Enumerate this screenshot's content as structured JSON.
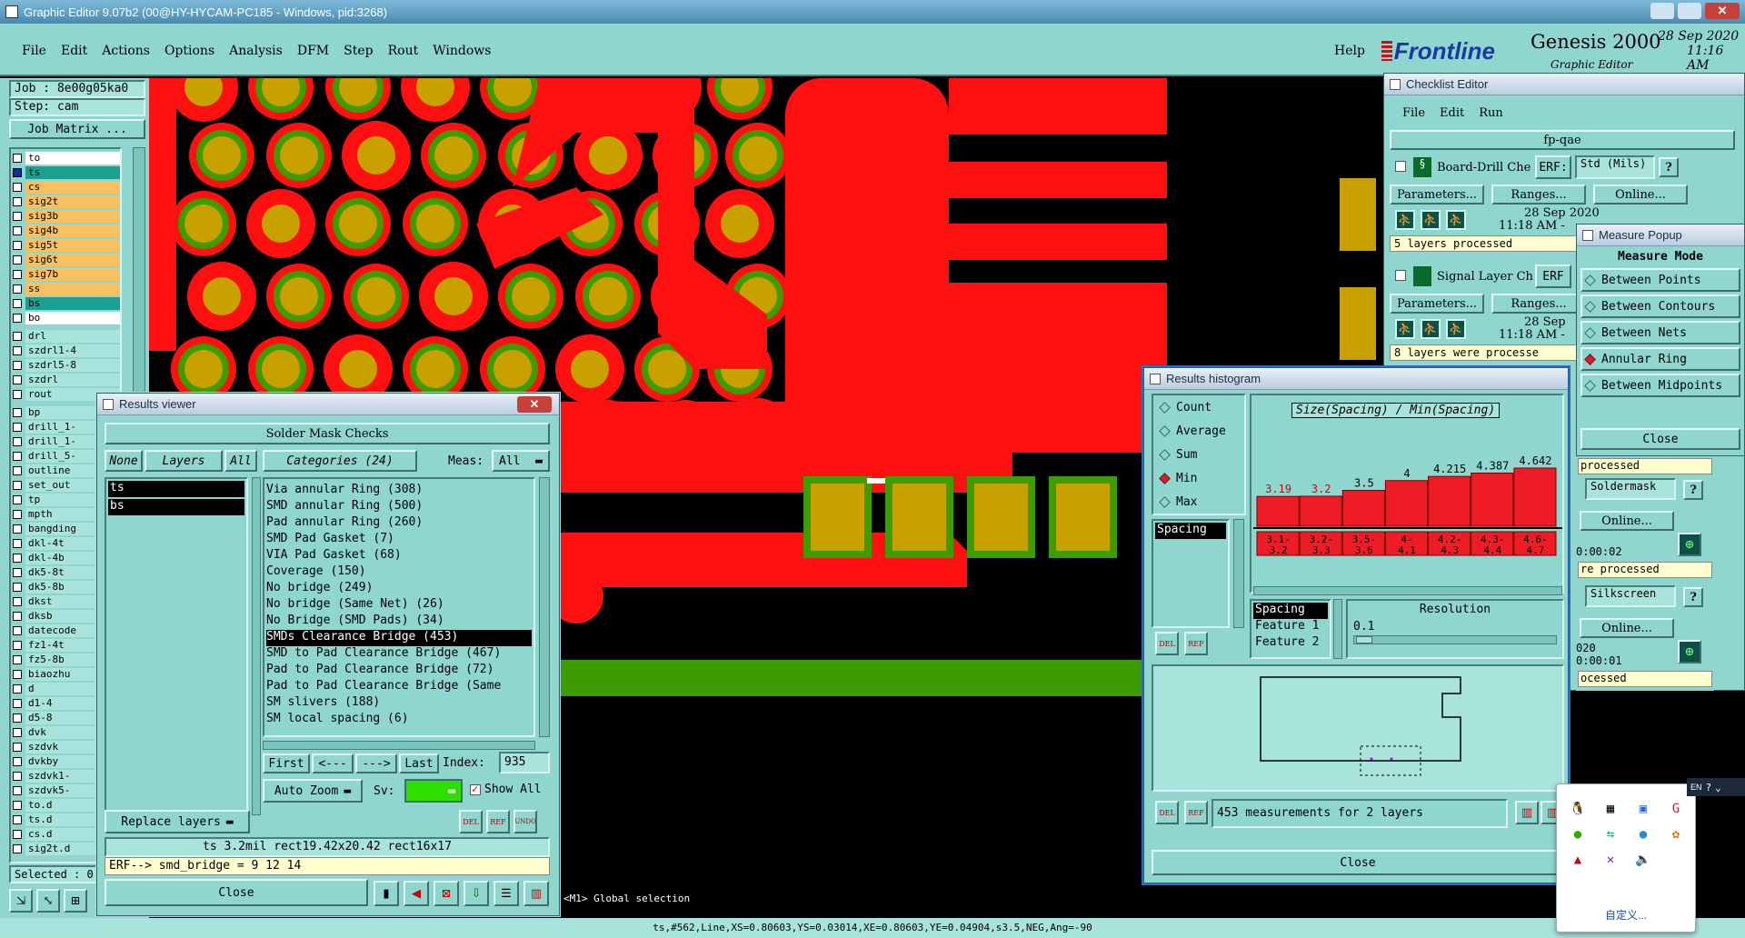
{
  "window": {
    "title": "Graphic Editor 9.07b2 (00@HY-HYCAM-PC185 - Windows, pid:3268)"
  },
  "menu": [
    "File",
    "Edit",
    "Actions",
    "Options",
    "Analysis",
    "DFM",
    "Step",
    "Rout",
    "Windows"
  ],
  "help_label": "Help",
  "brand": {
    "logo": "Frontline",
    "product": "Genesis 2000",
    "date": "28 Sep 2020",
    "time": "11:16 AM",
    "subtitle": "Graphic Editor"
  },
  "job": {
    "job_label": "Job : 8e00g05ka0",
    "step_label": "Step: cam",
    "matrix_button": "Job Matrix ..."
  },
  "layers": [
    {
      "name": "to",
      "color": "#ffffff"
    },
    {
      "name": "ts",
      "color": "#19a090"
    },
    {
      "name": "cs",
      "color": "#f8c060"
    },
    {
      "name": "sig2t",
      "color": "#f8c060"
    },
    {
      "name": "sig3b",
      "color": "#f8c060"
    },
    {
      "name": "sig4b",
      "color": "#f8c060"
    },
    {
      "name": "sig5t",
      "color": "#f8c060"
    },
    {
      "name": "sig6t",
      "color": "#f8c060"
    },
    {
      "name": "sig7b",
      "color": "#f8c060"
    },
    {
      "name": "ss",
      "color": "#f8c060"
    },
    {
      "name": "bs",
      "color": "#19a090"
    },
    {
      "name": "bo",
      "color": "#ffffff"
    },
    {
      "name": "drl",
      "color": "#a8e3dc"
    },
    {
      "name": "szdrl1-4",
      "color": "#a8e3dc"
    },
    {
      "name": "szdrl5-8",
      "color": "#a8e3dc"
    },
    {
      "name": "szdrl",
      "color": "#a8e3dc"
    },
    {
      "name": "rout",
      "color": "#a8e3dc"
    },
    {
      "name": "bp",
      "color": "#a8e3dc"
    },
    {
      "name": "drill_1-",
      "color": "#a8e3dc"
    },
    {
      "name": "drill_1-",
      "color": "#a8e3dc"
    },
    {
      "name": "drill_5-",
      "color": "#a8e3dc"
    },
    {
      "name": "outline",
      "color": "#a8e3dc"
    },
    {
      "name": "set_out",
      "color": "#a8e3dc"
    },
    {
      "name": "tp",
      "color": "#a8e3dc"
    },
    {
      "name": "mpth",
      "color": "#a8e3dc"
    },
    {
      "name": "bangding",
      "color": "#a8e3dc"
    },
    {
      "name": "dkl-4t",
      "color": "#a8e3dc"
    },
    {
      "name": "dkl-4b",
      "color": "#a8e3dc"
    },
    {
      "name": "dk5-8t",
      "color": "#a8e3dc"
    },
    {
      "name": "dk5-8b",
      "color": "#a8e3dc"
    },
    {
      "name": "dkst",
      "color": "#a8e3dc"
    },
    {
      "name": "dksb",
      "color": "#a8e3dc"
    },
    {
      "name": "datecode",
      "color": "#a8e3dc"
    },
    {
      "name": "fz1-4t",
      "color": "#a8e3dc"
    },
    {
      "name": "fz5-8b",
      "color": "#a8e3dc"
    },
    {
      "name": "biaozhu",
      "color": "#a8e3dc"
    },
    {
      "name": "d",
      "color": "#a8e3dc"
    },
    {
      "name": "d1-4",
      "color": "#a8e3dc"
    },
    {
      "name": "d5-8",
      "color": "#a8e3dc"
    },
    {
      "name": "dvk",
      "color": "#a8e3dc"
    },
    {
      "name": "szdvk",
      "color": "#a8e3dc"
    },
    {
      "name": "dvkby",
      "color": "#a8e3dc"
    },
    {
      "name": "szdvk1-",
      "color": "#a8e3dc"
    },
    {
      "name": "szdvk5-",
      "color": "#a8e3dc"
    },
    {
      "name": "to.d",
      "color": "#a8e3dc"
    },
    {
      "name": "ts.d",
      "color": "#a8e3dc"
    },
    {
      "name": "cs.d",
      "color": "#a8e3dc"
    },
    {
      "name": "sig2t.d",
      "color": "#a8e3dc"
    }
  ],
  "selected_label": "Selected : 0",
  "status": {
    "prompt": "<M1> Global selection",
    "bottom": "ts,#562,Line,XS=0.80603,YS=0.03014,XE=0.80603,YE=0.04904,s3.5,NEG,Ang=-90"
  },
  "results_viewer": {
    "title": "Results viewer",
    "heading": "Solder Mask Checks",
    "none_btn": "None",
    "layers_btn": "Layers",
    "all_btn": "All",
    "categories_label": "Categories (24)",
    "meas_label": "Meas:",
    "meas_value": "All",
    "layer_items": [
      "ts",
      "bs"
    ],
    "categories": [
      "Via annular Ring (308)",
      "SMD annular Ring (500)",
      "Pad annular Ring (260)",
      "SMD Pad Gasket (7)",
      "VIA Pad Gasket (68)",
      "Coverage (150)",
      "No bridge (249)",
      "No bridge (Same Net) (26)",
      "No Bridge (SMD Pads) (34)",
      "SMDs Clearance Bridge (453)",
      "SMD to Pad Clearance Bridge (467)",
      "Pad to Pad Clearance Bridge (72)",
      "Pad to Pad Clearance Bridge (Same",
      "SM slivers (188)",
      "SM local spacing (6)"
    ],
    "selected_category": 9,
    "first": "First",
    "prev": "<---",
    "next": "--->",
    "last": "Last",
    "index_label": "Index:",
    "index_value": "935",
    "auto_zoom": "Auto Zoom",
    "sv_label": "Sv:",
    "show_all": "Show All",
    "replace_layers": "Replace layers",
    "info_line": "ts 3.2mil   rect19.42x20.42   rect16x17",
    "erf_line": "ERF--> smd_bridge = 9 12 14",
    "close": "Close"
  },
  "checklist": {
    "title": "Checklist Editor",
    "menu": [
      "File",
      "Edit",
      "Run"
    ],
    "name": "fp-qae",
    "checks": [
      {
        "name": "Board-Drill Che",
        "erf": "ERF:",
        "erf_value": "Std (Mils)",
        "date": "28 Sep 2020",
        "time": "11:18 AM -",
        "status": "5 layers processed"
      },
      {
        "name": "Signal Layer Ch",
        "erf": "ERF",
        "erf_value": "",
        "date": "28 Sep",
        "time": "11:18 AM -",
        "status": "8 layers were processe"
      }
    ],
    "parameters": "Parameters...",
    "ranges": "Ranges...",
    "online": "Online...",
    "partial": [
      {
        "status": "processed",
        "erf_value": "Soldermask",
        "online": "Online...",
        "time": "0:00:02",
        "status2": "re processed"
      },
      {
        "erf_value": "Silkscreen",
        "online": "Online...",
        "date": "020",
        "time": "0:00:01",
        "status2": "ocessed"
      }
    ]
  },
  "measure": {
    "title": "Measure Popup",
    "mode_label": "Measure Mode",
    "modes": [
      "Between Points",
      "Between Contours",
      "Between Nets",
      "Annular Ring",
      "Between Midpoints"
    ],
    "selected_mode": 3,
    "close": "Close"
  },
  "histogram": {
    "title": "Results histogram",
    "stats": [
      "Count",
      "Average",
      "Sum",
      "Min",
      "Max"
    ],
    "selected_stat": 3,
    "spacing_item": "Spacing",
    "chart_title": "Size(Spacing) / Min(Spacing)",
    "chart_data": {
      "type": "bar",
      "categories": [
        "3.1-3.2",
        "3.2-3.3",
        "3.5-3.6",
        "4-4.1",
        "4.2-4.3",
        "4.3-4.4",
        "4.6-4.7"
      ],
      "values": [
        3.19,
        3.2,
        3.5,
        4,
        4.215,
        4.387,
        4.642
      ],
      "value_labels": [
        "3.19",
        "3.2",
        "3.5",
        "4",
        "4.215",
        "4.387",
        "4.642"
      ],
      "bar_color": "#ee1c24",
      "ylim": [
        0,
        4.642
      ]
    },
    "feature_labels": [
      "Spacing",
      "Feature 1",
      "Feature 2"
    ],
    "resolution_label": "Resolution",
    "resolution_value": "0.1",
    "summary": "453 measurements for 2 layers",
    "close": "Close",
    "del": "DEL",
    "ref": "REF"
  },
  "tray": {
    "lang": "EN",
    "customize": "自定义..."
  },
  "colors": {
    "panel": "#8fd6cf",
    "copper_red": "#ff1010",
    "pad_gold": "#c8a000",
    "mask_green": "#3c9c00"
  }
}
